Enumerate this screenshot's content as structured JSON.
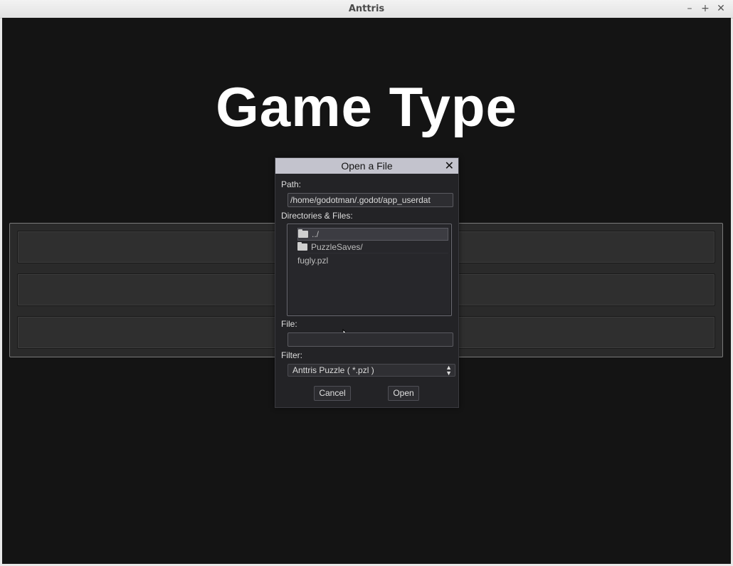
{
  "window": {
    "title": "Anttris",
    "controls": {
      "minimize": "–",
      "maximize": "+",
      "close": "✕"
    }
  },
  "screen": {
    "heading": "Game Type",
    "option_buttons": [
      "",
      "",
      ""
    ]
  },
  "dialog": {
    "title": "Open a File",
    "close_icon": "✕",
    "path_label": "Path:",
    "path_value": "/home/godotman/.godot/app_userdat",
    "dirs_label": "Directories & Files:",
    "items": [
      {
        "label": "../",
        "type": "folder",
        "selected": true
      },
      {
        "label": "PuzzleSaves/",
        "type": "folder",
        "selected": false
      },
      {
        "label": "fugly.pzl",
        "type": "file",
        "selected": false
      }
    ],
    "file_label": "File:",
    "file_value": "",
    "filter_label": "Filter:",
    "filter_value": "Anttris Puzzle ( *.pzl )",
    "cancel_label": "Cancel",
    "open_label": "Open"
  },
  "colors": {
    "background": "#141414",
    "dialog_title_bg": "#c3c3cd",
    "dialog_bg": "#232326"
  }
}
